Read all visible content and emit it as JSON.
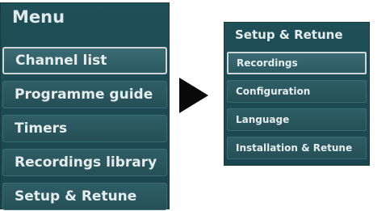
{
  "main_menu": {
    "title": "Menu",
    "items": [
      {
        "label": "Channel list"
      },
      {
        "label": "Programme guide"
      },
      {
        "label": "Timers"
      },
      {
        "label": "Recordings library"
      },
      {
        "label": "Setup & Retune"
      }
    ]
  },
  "arrow": {
    "icon": "right-triangle-icon"
  },
  "submenu": {
    "title": "Setup & Retune",
    "items": [
      {
        "label": "Recordings"
      },
      {
        "label": "Configuration"
      },
      {
        "label": "Language"
      },
      {
        "label": "Installation & Retune"
      }
    ]
  }
}
